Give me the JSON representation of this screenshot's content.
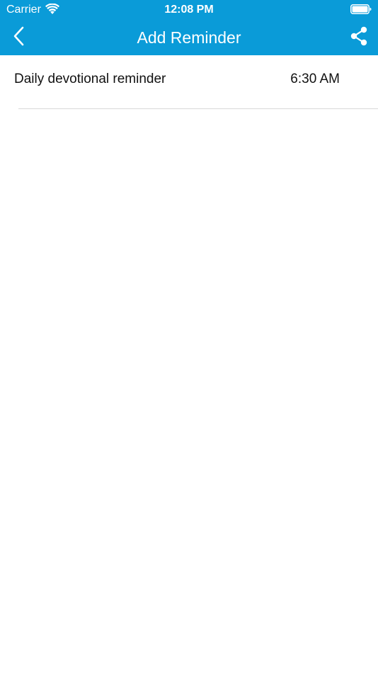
{
  "status_bar": {
    "carrier": "Carrier",
    "time": "12:08 PM",
    "wifi_icon": "wifi-icon",
    "battery_icon": "battery-full-icon"
  },
  "nav": {
    "title": "Add Reminder",
    "back_icon": "chevron-left-icon",
    "share_icon": "share-icon"
  },
  "reminders": [
    {
      "label": "Daily devotional reminder",
      "time": "6:30 AM"
    }
  ],
  "colors": {
    "header_background": "#0a9bd8",
    "text": "#111111",
    "divider": "#d9d9d9"
  }
}
